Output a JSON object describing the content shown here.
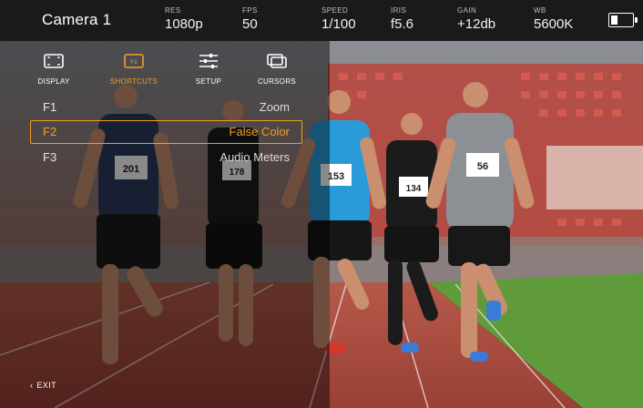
{
  "camera": {
    "title": "Camera 1"
  },
  "status": [
    {
      "label": "RES",
      "value": "1080p"
    },
    {
      "label": "FPS",
      "value": "50"
    },
    {
      "label": "SPEED",
      "value": "1/100"
    },
    {
      "label": "IRIS",
      "value": "f5.6"
    },
    {
      "label": "GAIN",
      "value": "+12db"
    },
    {
      "label": "WB",
      "value": "5600K"
    }
  ],
  "battery": {
    "level": 0.35
  },
  "tabs": [
    {
      "label": "DISPLAY",
      "icon": "display-icon",
      "active": false
    },
    {
      "label": "SHORTCUTS",
      "icon": "shortcut-f1-icon",
      "active": true
    },
    {
      "label": "SETUP",
      "icon": "sliders-icon",
      "active": false
    },
    {
      "label": "CURSORS",
      "icon": "cursors-icon",
      "active": false
    }
  ],
  "shortcuts": [
    {
      "key": "F1",
      "function": "Zoom",
      "selected": false
    },
    {
      "key": "F2",
      "function": "False Color",
      "selected": true
    },
    {
      "key": "F3",
      "function": "Audio Meters",
      "selected": false
    }
  ],
  "exit": {
    "label": "EXIT"
  },
  "runners": [
    "201",
    "178",
    "153",
    "134",
    "56"
  ],
  "colors": {
    "accent": "#f0a020",
    "topbar": "#1a1a1a"
  }
}
